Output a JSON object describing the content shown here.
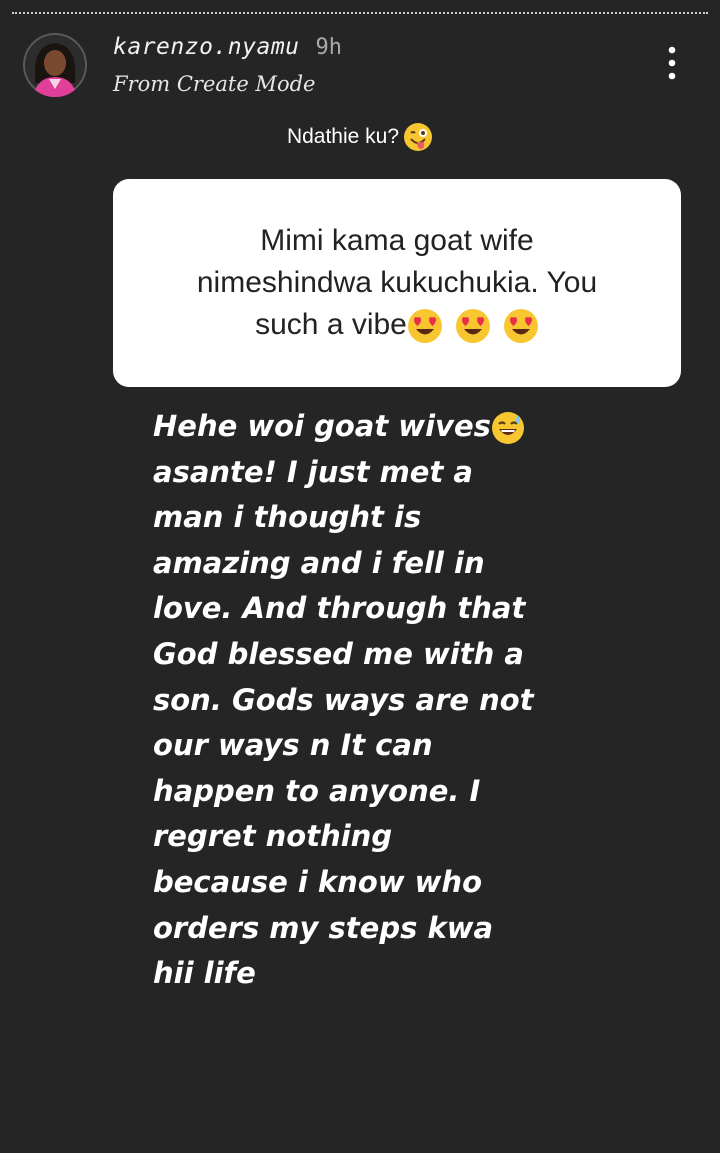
{
  "header": {
    "username": "karenzo.nyamu",
    "time_ago": "9h",
    "subtitle": "From Create Mode",
    "more_icon": "more-vertical-icon",
    "avatar": "profile-photo"
  },
  "story": {
    "progress_segments": 1,
    "question_title": "Ndathie ku?",
    "question_title_emoji": "winking-face-with-tongue",
    "question_card": {
      "lines": [
        "Mimi kama goat wife",
        "nimeshindwa kukuchukia. You",
        "such a vibe"
      ],
      "trailing_emojis": [
        "heart-eyes",
        "heart-eyes",
        "heart-eyes"
      ]
    },
    "answer": {
      "lines": [
        "Hehe woi goat wives",
        "asante! I just met a",
        "man i thought is",
        "amazing and i fell in",
        "love. And through that",
        "God blessed me with a",
        "son. Gods ways are not",
        "our ways n It can",
        "happen to anyone. I",
        "regret nothing",
        "because i know who",
        "orders my steps kwa",
        "hii life"
      ],
      "first_line_emoji": "grinning-sweat"
    }
  },
  "colors": {
    "background": "#252525",
    "card": "#ffffff",
    "text_light": "#ffffff",
    "text_dark": "#222222"
  }
}
